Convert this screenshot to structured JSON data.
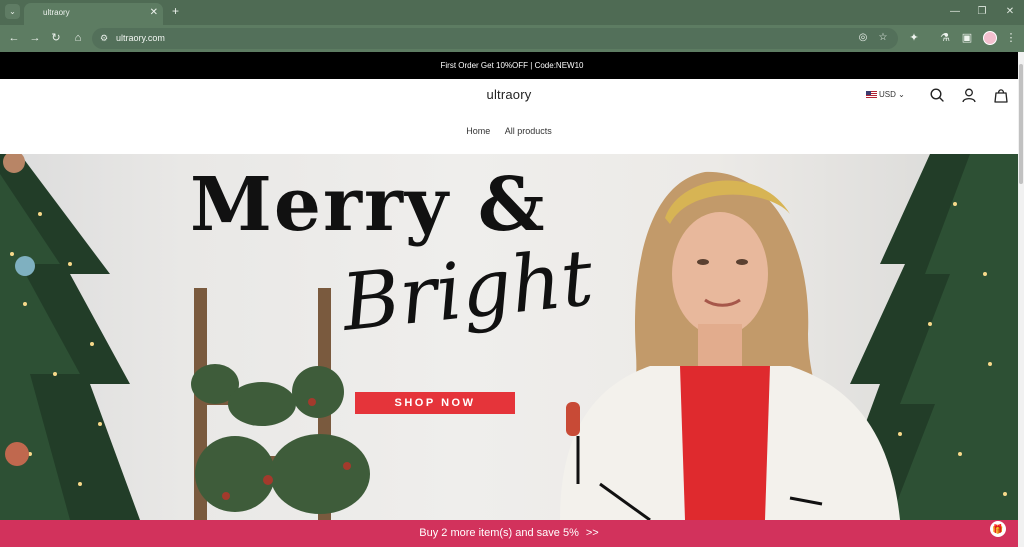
{
  "browser": {
    "tab_title": "ultraory",
    "tab_menu_icon": "chevron-down-icon",
    "tab_close": "✕",
    "new_tab": "+",
    "url": "ultraory.com",
    "window_minimize": "—",
    "window_restore": "❐",
    "window_close": "✕"
  },
  "announcement": {
    "text": "First Order Get 10%OFF | Code:NEW10"
  },
  "header": {
    "logo": "ultraory",
    "currency": "USD",
    "nav": [
      "Home",
      "All products"
    ]
  },
  "hero": {
    "headline": "Merry &",
    "script": "Bright",
    "cta": "SHOP NOW",
    "cta_color": "#e5343a"
  },
  "promo": {
    "text": "Buy 2 more item(s) and save 5%",
    "arrow": ">>",
    "color": "#d2325c"
  }
}
